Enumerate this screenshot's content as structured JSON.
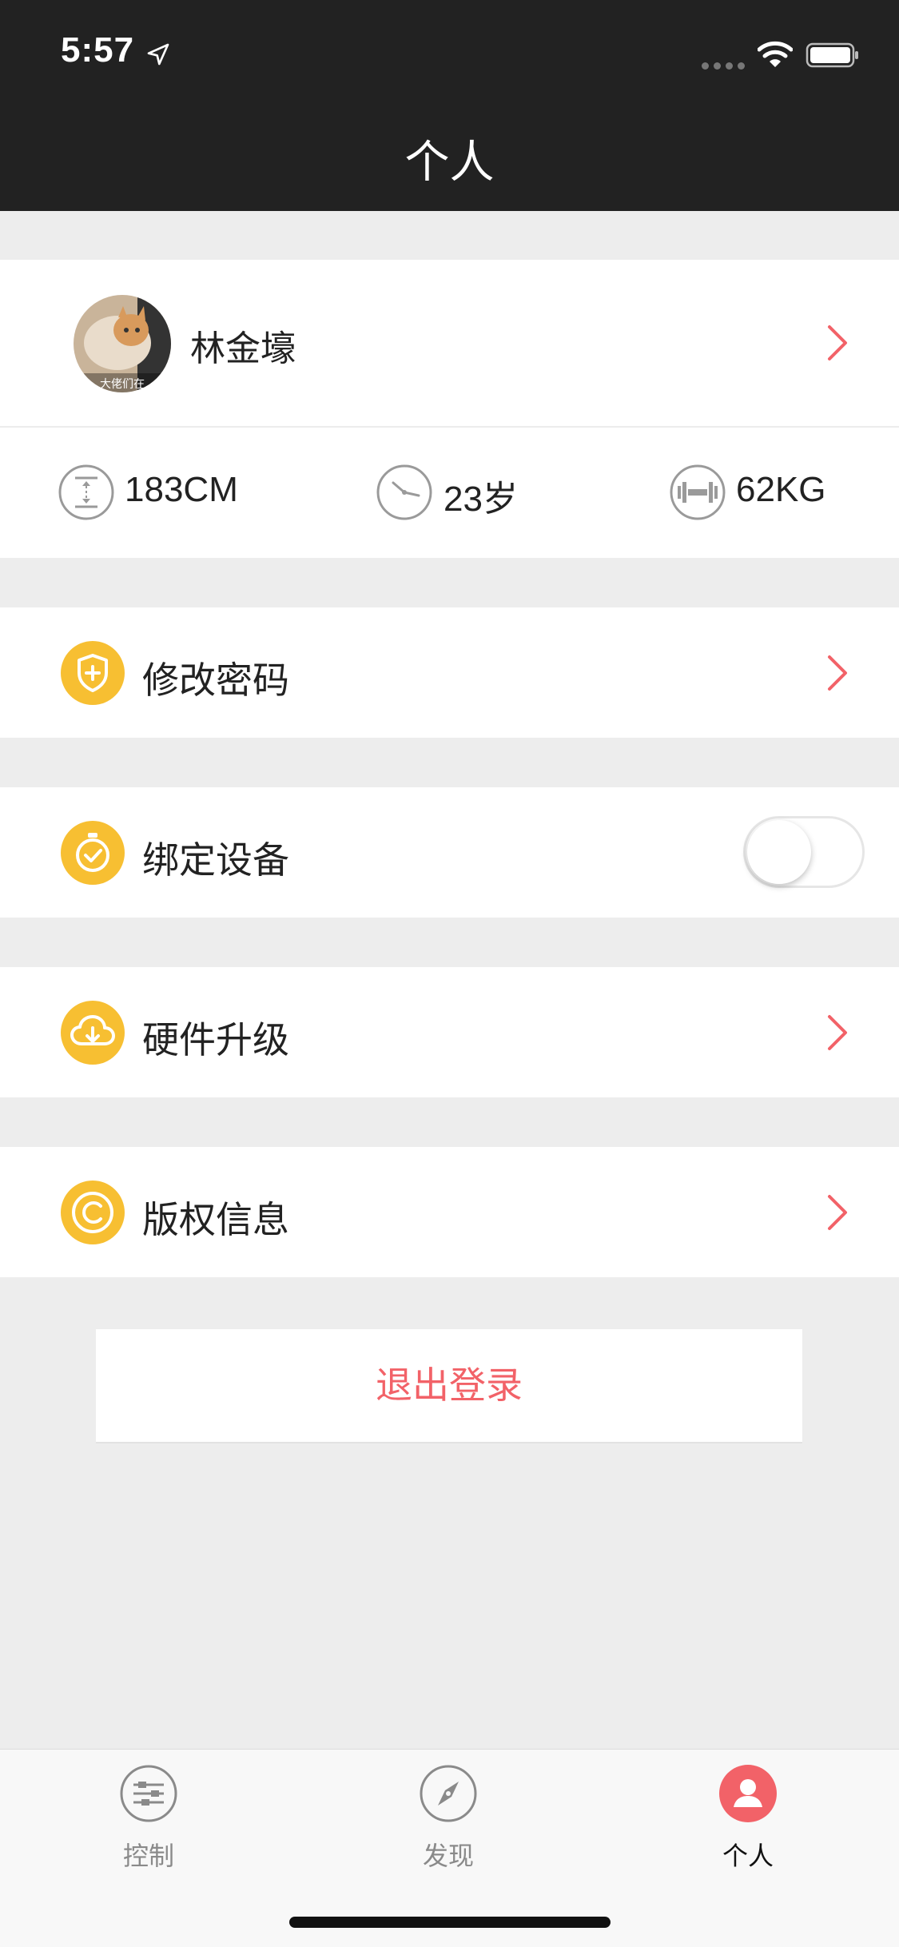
{
  "status_bar": {
    "time": "5:57"
  },
  "nav": {
    "title": "个人"
  },
  "profile": {
    "name": "林金壕",
    "avatar_caption": "大佬们在"
  },
  "stats": [
    {
      "icon": "height-icon",
      "value": "183CM"
    },
    {
      "icon": "clock-icon",
      "value": "23岁"
    },
    {
      "icon": "dumbbell-icon",
      "value": "62KG"
    }
  ],
  "menu": {
    "change_password": "修改密码",
    "bind_device": "绑定设备",
    "bind_device_enabled": false,
    "firmware_upgrade": "硬件升级",
    "copyright": "版权信息"
  },
  "logout_label": "退出登录",
  "tabs": [
    {
      "label": "控制",
      "icon": "sliders-icon",
      "active": false
    },
    {
      "label": "发现",
      "icon": "compass-icon",
      "active": false
    },
    {
      "label": "个人",
      "icon": "person-icon",
      "active": true
    }
  ],
  "colors": {
    "accent": "#f26268",
    "icon_yellow": "#f7bf32",
    "nav_bg": "#222222",
    "page_bg": "#ededed"
  }
}
